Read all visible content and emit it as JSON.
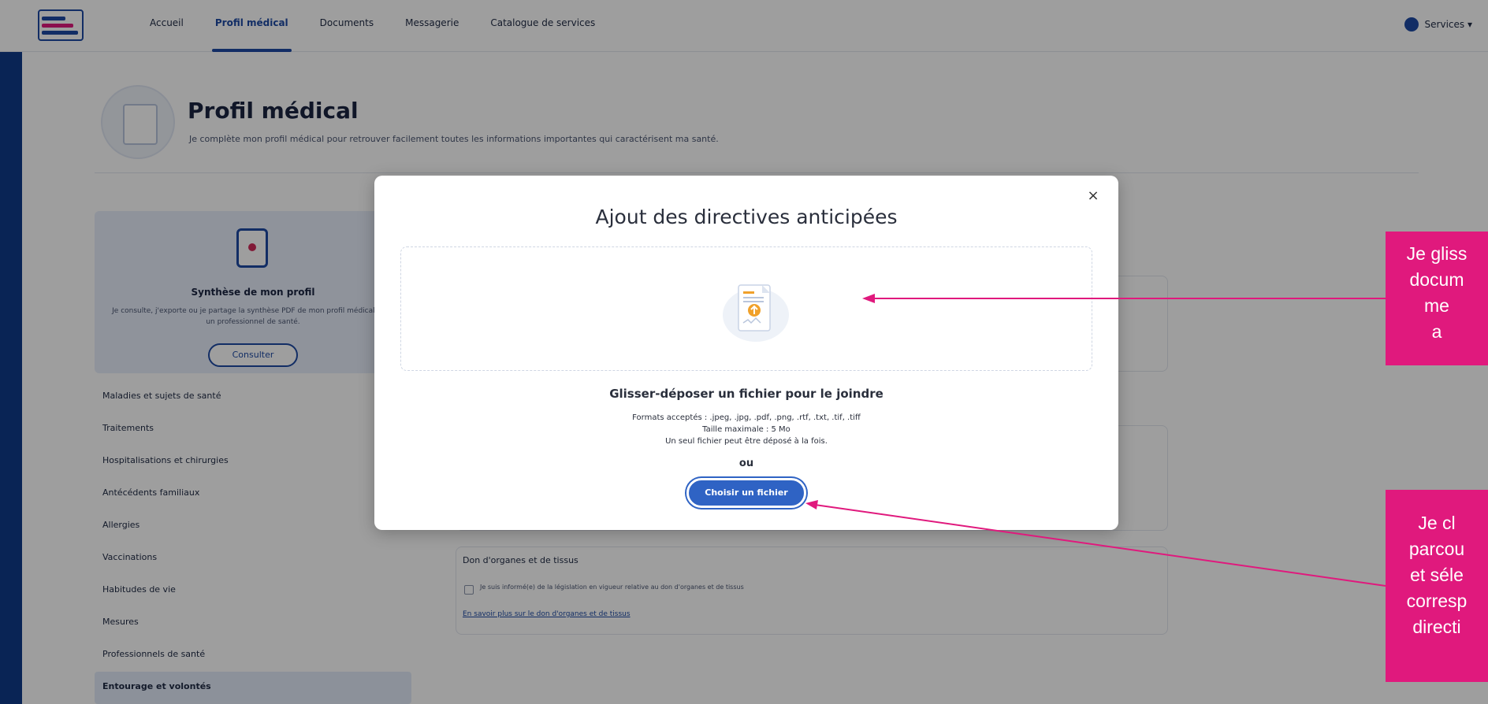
{
  "nav": {
    "items": [
      "Accueil",
      "Profil médical",
      "Documents",
      "Messagerie",
      "Catalogue de services"
    ],
    "active_index": 1,
    "user_label": "Services ▾"
  },
  "page": {
    "title": "Profil médical",
    "subtitle": "Je complète mon profil médical pour retrouver facilement toutes les informations importantes qui caractérisent ma santé."
  },
  "synthesis": {
    "title": "Synthèse de mon profil",
    "text": "Je consulte, j'exporte ou je partage la synthèse PDF de mon profil médical avec un professionnel de santé.",
    "button": "Consulter"
  },
  "sidebar": {
    "items": [
      "Maladies et sujets de santé",
      "Traitements",
      "Hospitalisations et chirurgies",
      "Antécédents familiaux",
      "Allergies",
      "Vaccinations",
      "Habitudes de vie",
      "Mesures",
      "Professionnels de santé",
      "Entourage et volontés"
    ],
    "active_index": 9
  },
  "organ_card": {
    "title": "Don d'organes et de tissus",
    "checkbox_text": "Je suis informé(e) de la législation en vigueur relative au don d'organes et de tissus",
    "link": "En savoir plus sur le don d'organes et de tissus"
  },
  "modal": {
    "title": "Ajout des directives anticipées",
    "close_symbol": "×",
    "drop_label": "Glisser-déposer un fichier pour le joindre",
    "formats": "Formats acceptés : .jpeg, .jpg, .pdf, .png, .rtf, .txt, .tif, .tiff",
    "max_size": "Taille maximale : 5 Mo",
    "single_file": "Un seul fichier peut être déposé à la fois.",
    "or": "ou",
    "choose_button": "Choisir un fichier"
  },
  "callouts": {
    "first": [
      "Je gliss",
      "docum",
      "me",
      "a"
    ],
    "second": [
      "Je cl",
      "parcou",
      "et séle",
      "corresp",
      "directi"
    ]
  },
  "colors": {
    "primary": "#1d4aa3",
    "button": "#2f63c4",
    "callout": "#e0197d",
    "overlay": "rgba(0,0,0,0.38)"
  }
}
